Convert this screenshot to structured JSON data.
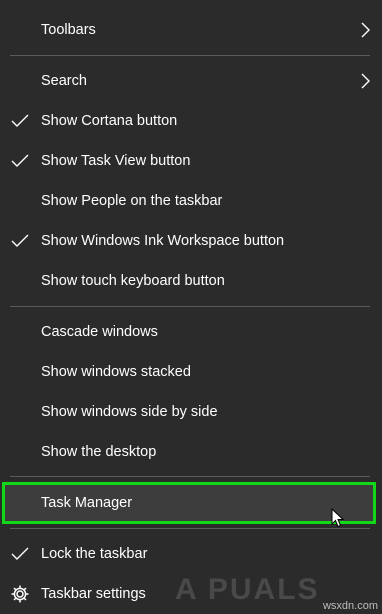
{
  "menu": {
    "items": [
      {
        "label": "Toolbars",
        "submenu": true
      },
      {
        "label": "Search",
        "submenu": true
      },
      {
        "label": "Show Cortana button",
        "checked": true
      },
      {
        "label": "Show Task View button",
        "checked": true
      },
      {
        "label": "Show People on the taskbar",
        "checked": false
      },
      {
        "label": "Show Windows Ink Workspace button",
        "checked": true
      },
      {
        "label": "Show touch keyboard button",
        "checked": false
      },
      {
        "label": "Cascade windows"
      },
      {
        "label": "Show windows stacked"
      },
      {
        "label": "Show windows side by side"
      },
      {
        "label": "Show the desktop"
      },
      {
        "label": "Task Manager",
        "highlighted": true
      },
      {
        "label": "Lock the taskbar",
        "checked": true
      },
      {
        "label": "Taskbar settings",
        "icon": "gear-icon"
      }
    ]
  },
  "watermark": {
    "text": "A PUALS"
  },
  "site": {
    "text": "wsxdn.com"
  },
  "colors": {
    "background": "#2b2b2b",
    "highlight_border": "#13d81a",
    "separator": "#5a5a5a",
    "text": "#ffffff"
  }
}
